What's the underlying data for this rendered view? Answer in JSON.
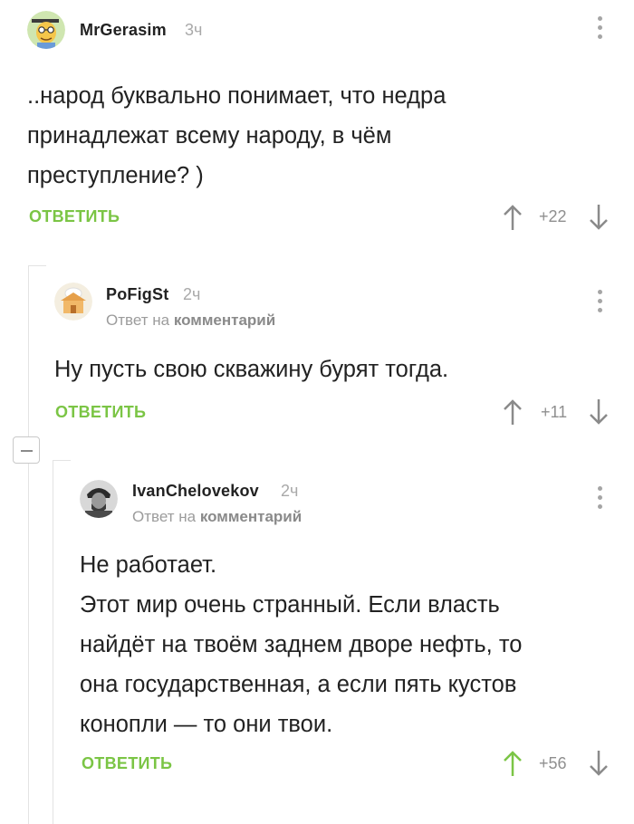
{
  "comments": [
    {
      "username": "MrGerasim",
      "time": "3ч",
      "text": "..народ буквально понимает, что недра\nпринадлежат всему народу, в чём\nпреступление? )",
      "reply_label": "ОТВЕТИТЬ",
      "score": "+22"
    },
    {
      "username": "PoFigSt",
      "time": "2ч",
      "reply_to_prefix": "Ответ на",
      "reply_to_link": "комментарий",
      "text": "Ну пусть свою скважину бурят тогда.",
      "reply_label": "ОТВЕТИТЬ",
      "score": "+11"
    },
    {
      "username": "IvanChelovekov",
      "time": "2ч",
      "reply_to_prefix": "Ответ на",
      "reply_to_link": "комментарий",
      "text": "Не работает.\nЭтот мир очень странный. Если власть\nнайдёт на твоём заднем дворе нефть, то\nона государственная, а если пять кустов\nконопли — то они твои.",
      "reply_label": "ОТВЕТИТЬ",
      "score": "+56"
    }
  ],
  "colors": {
    "accent_green": "#7bc545",
    "muted": "#a9a9a9",
    "text": "#222222",
    "upvoted": "#7bc545"
  },
  "icons": [
    "avatar-face-icon",
    "avatar-hut-icon",
    "avatar-photo-icon",
    "more-vertical-icon",
    "arrow-up-icon",
    "arrow-down-icon",
    "collapse-minus-icon"
  ]
}
